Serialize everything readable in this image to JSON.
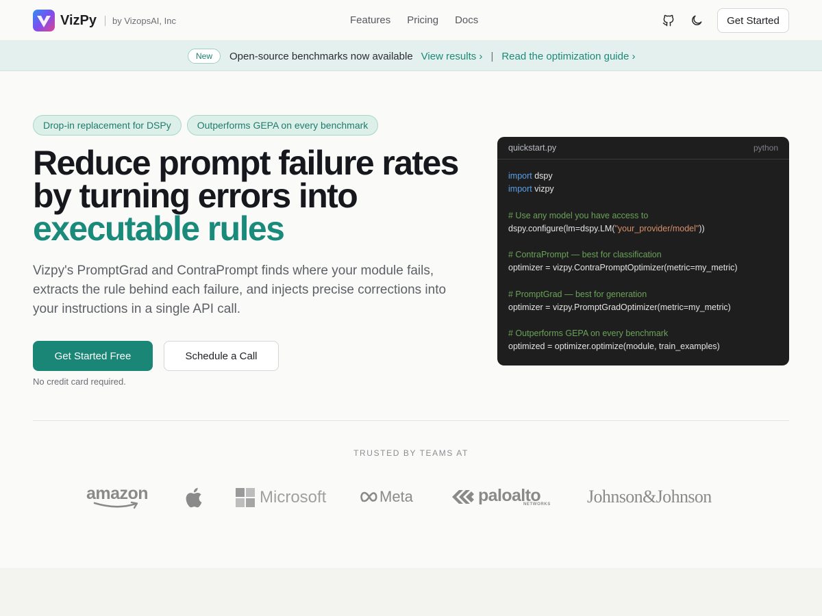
{
  "nav": {
    "brand_name": "VizPy",
    "brand_by": "by VizopsAI, Inc",
    "links": [
      "Features",
      "Pricing",
      "Docs"
    ],
    "cta": "Get Started",
    "icons": [
      "github-icon",
      "moon-icon"
    ]
  },
  "banner": {
    "badge": "New",
    "text": "Open-source benchmarks now available",
    "link1": "View results ›",
    "separator": "|",
    "link2": "Read the optimization guide ›"
  },
  "hero": {
    "tags": [
      "Drop-in replacement for DSPy",
      "Outperforms GEPA on every benchmark"
    ],
    "headline_line1": "Reduce prompt failure rates",
    "headline_line2": "by turning errors into",
    "headline_accent": "executable rules",
    "subtext": "Vizpy's PromptGrad and ContraPrompt finds where your module fails, extracts the rule behind each failure, and injects precise corrections into your instructions in a single API call.",
    "primary_button": "Get Started Free",
    "secondary_button": "Schedule a Call",
    "note": "No credit card required."
  },
  "code": {
    "filename": "quickstart.py",
    "language": "python",
    "lines": [
      [
        {
          "t": "kw",
          "v": "import"
        },
        {
          "t": "",
          "v": " dspy"
        }
      ],
      [
        {
          "t": "kw",
          "v": "import"
        },
        {
          "t": "",
          "v": " vizpy"
        }
      ],
      [],
      [
        {
          "t": "cm",
          "v": "# Use any model you have access to"
        }
      ],
      [
        {
          "t": "",
          "v": "dspy.configure(lm=dspy.LM("
        },
        {
          "t": "str",
          "v": "\"your_provider/model\""
        },
        {
          "t": "",
          "v": "))"
        }
      ],
      [],
      [
        {
          "t": "cm",
          "v": "# ContraPrompt — best for classification"
        }
      ],
      [
        {
          "t": "",
          "v": "optimizer = vizpy.ContraPromptOptimizer(metric=my_metric)"
        }
      ],
      [],
      [
        {
          "t": "cm",
          "v": "# PromptGrad — best for generation"
        }
      ],
      [
        {
          "t": "",
          "v": "optimizer = vizpy.PromptGradOptimizer(metric=my_metric)"
        }
      ],
      [],
      [
        {
          "t": "cm",
          "v": "# Outperforms GEPA on every benchmark"
        }
      ],
      [
        {
          "t": "",
          "v": "optimized = optimizer.optimize(module, train_examples)"
        }
      ]
    ]
  },
  "trusted": {
    "label": "TRUSTED BY TEAMS AT",
    "logos": {
      "amazon": "amazon",
      "apple": "apple-logo",
      "microsoft": "Microsoft",
      "meta": "Meta",
      "paloalto": "paloalto",
      "paloalto_sub": "NETWORKS",
      "jnj": "Johnson&Johnson"
    }
  },
  "colors": {
    "accent": "#1a8a7a",
    "primary_button": "#198676",
    "banner_bg": "#e4f0ed",
    "code_bg": "#1e1e1e"
  }
}
